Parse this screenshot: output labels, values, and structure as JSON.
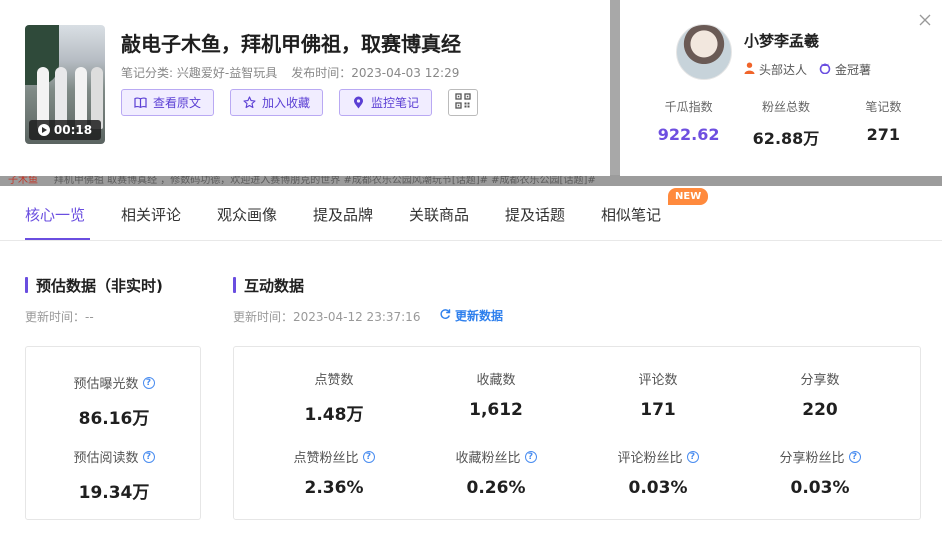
{
  "note": {
    "title": "敲电子木鱼，拜机甲佛祖，取赛博真经",
    "category": "笔记分类: 兴趣爱好-益智玩具",
    "publish_time": "发布时间：2023-04-03 12:29",
    "duration": "00:18",
    "actions": {
      "view_original": "查看原文",
      "add_favorite": "加入收藏",
      "monitor": "监控笔记"
    },
    "icons": {
      "book": "book-icon",
      "star": "star-icon",
      "location": "location-pin-icon",
      "qr": "qrcode-icon",
      "play": "play-icon"
    }
  },
  "background_ticker": {
    "left": "子木鱼",
    "text": "拜机甲佛祖 取赛博真经 ，修数码功德，欢迎进入赛博朋克的世界 #成都农乐公园风潮玩节[话题]# #成都农乐公园[话题]#"
  },
  "author": {
    "name": "小梦李孟羲",
    "tag1": "头部达人",
    "tag2": "金冠薯",
    "stats": [
      {
        "label": "千瓜指数",
        "value": "922.62"
      },
      {
        "label": "粉丝总数",
        "value": "62.88万"
      },
      {
        "label": "笔记数",
        "value": "271"
      }
    ]
  },
  "tabs": [
    "核心一览",
    "相关评论",
    "观众画像",
    "提及品牌",
    "关联商品",
    "提及话题",
    "相似笔记"
  ],
  "active_tab": "核心一览",
  "new_badge": "NEW",
  "estimate": {
    "title": "预估数据（非实时)",
    "updated": "更新时间：--",
    "exposure_label": "预估曝光数",
    "exposure_value": "86.16万",
    "reads_label": "预估阅读数",
    "reads_value": "19.34万"
  },
  "interaction": {
    "title": "互动数据",
    "updated": "更新时间：2023-04-12 23:37:16",
    "refresh": "更新数据",
    "metrics": [
      {
        "label": "点赞数",
        "value": "1.48万"
      },
      {
        "label": "收藏数",
        "value": "1,612"
      },
      {
        "label": "评论数",
        "value": "171"
      },
      {
        "label": "分享数",
        "value": "220"
      }
    ],
    "ratios": [
      {
        "label": "点赞粉丝比",
        "value": "2.36%"
      },
      {
        "label": "收藏粉丝比",
        "value": "0.26%"
      },
      {
        "label": "评论粉丝比",
        "value": "0.03%"
      },
      {
        "label": "分享粉丝比",
        "value": "0.03%"
      }
    ]
  },
  "colors": {
    "accent": "#6a4ee0",
    "new_badge": "#ff8a3d",
    "link_blue": "#2f80ed"
  }
}
